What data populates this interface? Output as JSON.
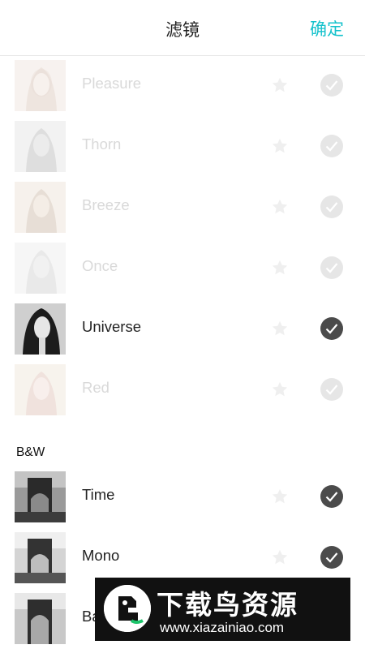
{
  "header": {
    "title": "滤镜",
    "confirm_label": "确定"
  },
  "filters_color": [
    {
      "name": "Pleasure",
      "selected": false,
      "active": false,
      "tint": "#c9b2a4"
    },
    {
      "name": "Thorn",
      "selected": false,
      "active": false,
      "tint": "#9a9a9a"
    },
    {
      "name": "Breeze",
      "selected": false,
      "active": false,
      "tint": "#b59c84"
    },
    {
      "name": "Once",
      "selected": false,
      "active": false,
      "tint": "#bdbdbd"
    },
    {
      "name": "Universe",
      "selected": true,
      "active": true,
      "tint": "#6f6f6f"
    },
    {
      "name": "Red",
      "selected": false,
      "active": false,
      "tint": "#d6a6a0"
    }
  ],
  "section_bw": {
    "title": "B&W"
  },
  "filters_bw": [
    {
      "name": "Time",
      "selected": true
    },
    {
      "name": "Mono",
      "selected": true
    },
    {
      "name": "Ba"
    }
  ],
  "watermark": {
    "text": "下载鸟资源",
    "url": "www.xiazainiao.com"
  },
  "colors": {
    "accent": "#16c2cc",
    "check_on": "#4b4b4b",
    "check_off": "#e6e6e6"
  }
}
